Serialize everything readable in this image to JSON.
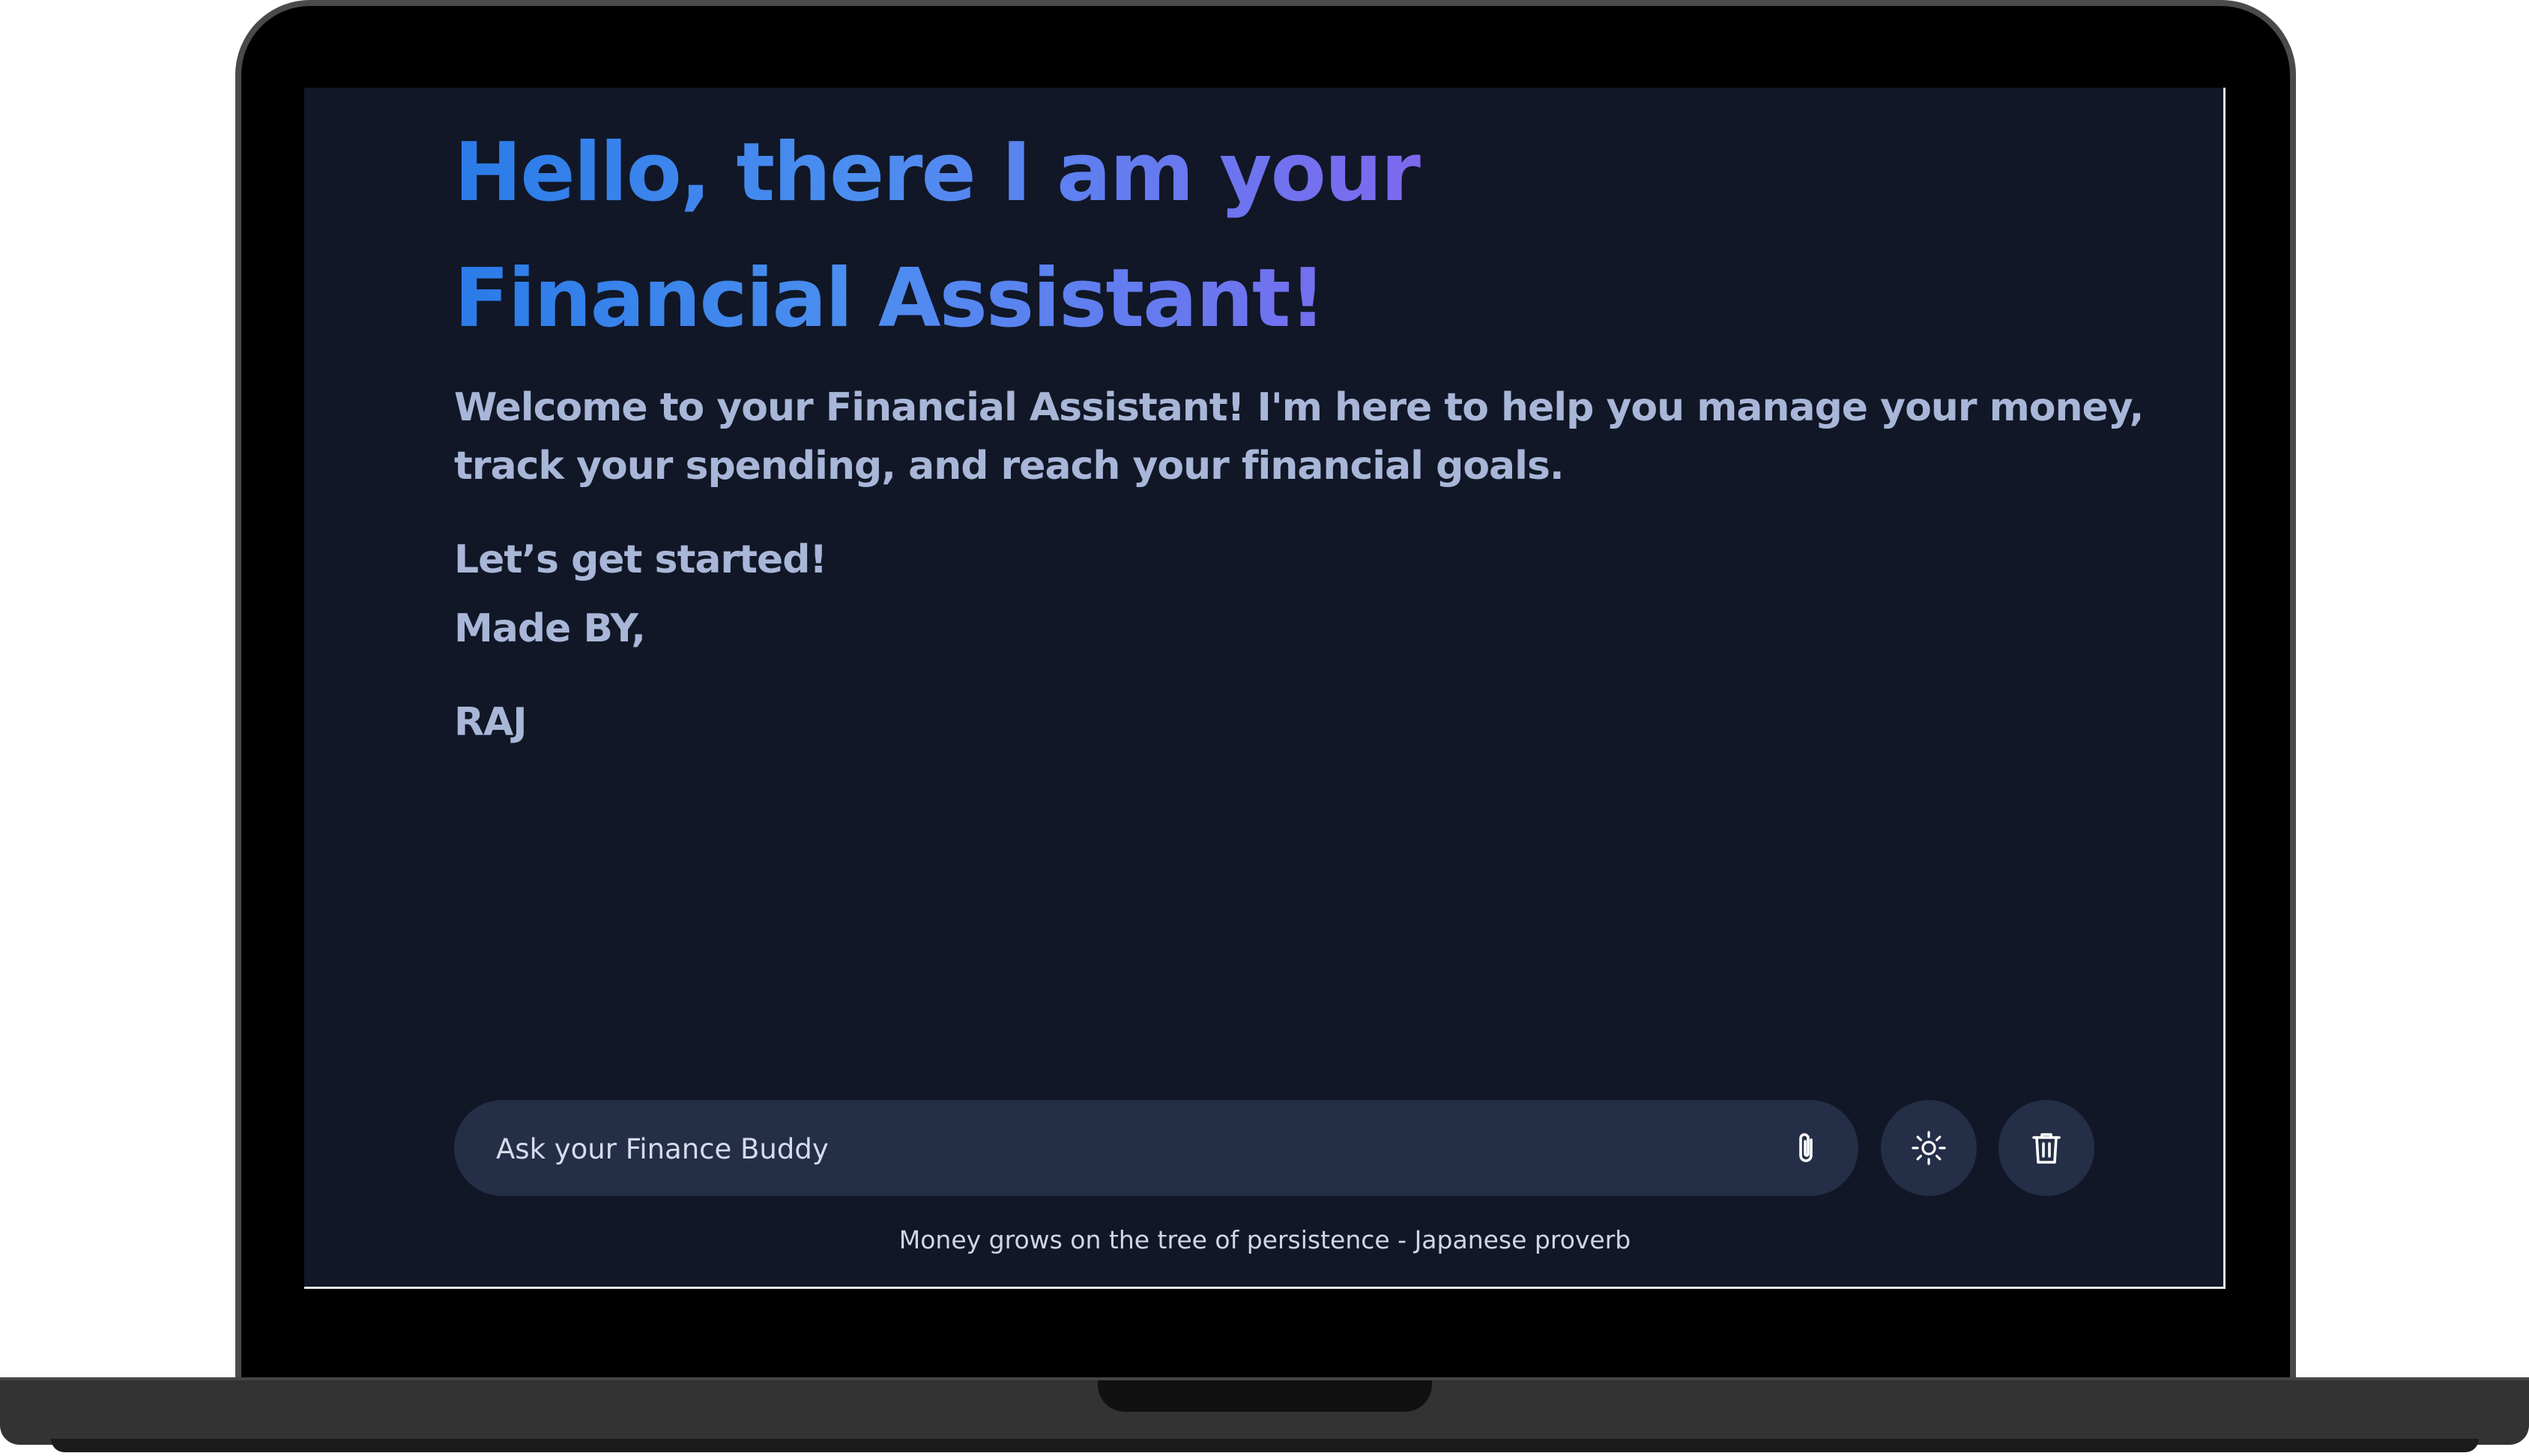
{
  "hero": {
    "title": "Hello, there I am your Financial Assistant!",
    "welcome": "Welcome to your Financial Assistant! I'm here to help you manage your money, track your spending, and reach your financial goals.",
    "cta": "Let’s get started!",
    "made_by": "Made BY,",
    "author": "RAJ"
  },
  "composer": {
    "placeholder": "Ask your Finance Buddy",
    "value": "",
    "attach_icon": "paperclip-icon",
    "theme_icon": "sun-icon",
    "delete_icon": "trash-icon"
  },
  "footer": {
    "quote": "Money grows on the tree of persistence - Japanese proverb"
  },
  "colors": {
    "screen_bg": "#111726",
    "input_bg": "#252e47",
    "title_gradient_start": "#2a7be8",
    "title_gradient_end": "#8365ee",
    "body_text": "#a8b6d8"
  }
}
